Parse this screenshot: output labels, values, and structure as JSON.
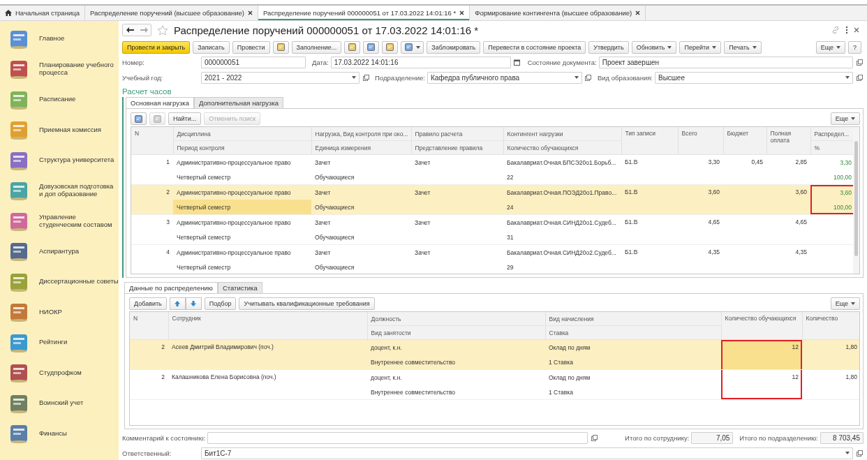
{
  "top_tabs": [
    {
      "label": "Начальная страница",
      "home": true,
      "closable": false,
      "selected": false
    },
    {
      "label": "Распределение поручений (высшее образование)",
      "home": false,
      "closable": true,
      "selected": false
    },
    {
      "label": "Распределение поручений 000000051 от 17.03.2022 14:01:16 *",
      "home": false,
      "closable": true,
      "selected": true
    },
    {
      "label": "Формирование контингента (высшее образование)",
      "home": false,
      "closable": true,
      "selected": false
    }
  ],
  "sidebar": {
    "items": [
      {
        "label": "Главное"
      },
      {
        "label": "Планирование учебного процесса"
      },
      {
        "label": "Расписание"
      },
      {
        "label": "Приемная комиссия"
      },
      {
        "label": "Структура университета"
      },
      {
        "label": "Довузовская подготовка и доп образование"
      },
      {
        "label": "Управление студенческим составом"
      },
      {
        "label": "Аспирантура"
      },
      {
        "label": "Диссертационные советы"
      },
      {
        "label": "НИОКР"
      },
      {
        "label": "Рейтинги"
      },
      {
        "label": "Студпрофком"
      },
      {
        "label": "Воинский учет"
      },
      {
        "label": "Финансы"
      }
    ]
  },
  "document": {
    "title": "Распределение поручений 000000051 от 17.03.2022 14:01:16 *",
    "command_bar": [
      {
        "kind": "primary",
        "label": "Провести и закрыть"
      },
      {
        "kind": "plain",
        "label": "Записать"
      },
      {
        "kind": "plain",
        "label": "Провести"
      },
      {
        "kind": "icon"
      },
      {
        "kind": "plain",
        "label": "Заполнение..."
      },
      {
        "kind": "icon"
      },
      {
        "kind": "icon"
      },
      {
        "kind": "icon"
      },
      {
        "kind": "icon_menu"
      },
      {
        "kind": "plain",
        "label": "Заблокировать"
      },
      {
        "kind": "plain",
        "label": "Перевести в состояние проекта"
      },
      {
        "kind": "plain",
        "label": "Утвердить"
      },
      {
        "kind": "menu",
        "label": "Обновить"
      },
      {
        "kind": "menu",
        "label": "Перейти"
      },
      {
        "kind": "menu",
        "label": "Печать"
      },
      {
        "kind": "spacer"
      },
      {
        "kind": "menu",
        "label": "Еще"
      },
      {
        "kind": "plain",
        "label": "?"
      }
    ],
    "number": {
      "label": "Номер:",
      "value": "000000051"
    },
    "date": {
      "label": "Дата:",
      "value": "17.03.2022 14:01:16"
    },
    "state": {
      "label": "Состояние документа:",
      "value": "Проект завершен"
    },
    "year": {
      "label": "Учебный год:",
      "value": "2021 - 2022"
    },
    "department": {
      "label": "Подразделение:",
      "value": "Кафедра публичного права"
    },
    "education": {
      "label": "Вид образования:",
      "value": "Высшее"
    },
    "section_title": "Расчет часов",
    "load_tabs": [
      {
        "label": "Основная нагрузка",
        "selected": true
      },
      {
        "label": "Дополнительная нагрузка",
        "selected": false
      }
    ],
    "load_toolbar": [
      {
        "kind": "icon",
        "disabled": false
      },
      {
        "kind": "icon",
        "disabled": true
      },
      {
        "kind": "plain",
        "label": "Найти...",
        "disabled": false
      },
      {
        "kind": "plain",
        "label": "Отменить поиск",
        "disabled": true
      },
      {
        "kind": "spacer"
      },
      {
        "kind": "menu",
        "label": "Еще",
        "disabled": false
      }
    ],
    "load_table": {
      "columns": [
        {
          "top": "N"
        },
        {
          "top": "Дисциплина",
          "bottom": "Период контроля"
        },
        {
          "top": "Нагрузка, Вид контроля при око...",
          "bottom": "Единица измерения"
        },
        {
          "top": "Правило расчета",
          "bottom": "Представление правила"
        },
        {
          "top": "Контингент нагрузки",
          "bottom": "Количество обучающихся"
        },
        {
          "top": "Тип записи"
        },
        {
          "top": "Всего"
        },
        {
          "top": "Бюджет"
        },
        {
          "top": "Полная оплата"
        },
        {
          "top": "Распредел...",
          "bottom": "%"
        }
      ],
      "rows": [
        {
          "n": "1",
          "discipline": "Административно-процессуальное право",
          "period": "Четвертый семестр",
          "load": "Зачет",
          "unit": "Обучающиеся",
          "rule": "Зачет",
          "contingent": "Бакалавриат.Очная.БПСЭ20о1.Борьб...",
          "students": "22",
          "record_type": "Б1.В",
          "total": "3,30",
          "budget": "0,45",
          "full_pay": "2,85",
          "dist": "3,30",
          "dist_pct": "100,00",
          "selected": false,
          "focused": false,
          "marked": false
        },
        {
          "n": "2",
          "discipline": "Административно-процессуальное право",
          "period": "Четвертый семестр",
          "load": "Зачет",
          "unit": "Обучающиеся",
          "rule": "Зачет",
          "contingent": "Бакалавриат.Очная.ПОЭД20о1.Право...",
          "students": "24",
          "record_type": "Б1.В",
          "total": "3,60",
          "full_pay": "3,60",
          "dist": "3,60",
          "dist_pct": "100,00",
          "selected": true,
          "focused": true,
          "marked": true
        },
        {
          "n": "3",
          "discipline": "Административно-процессуальное право",
          "period": "Четвертый семестр",
          "load": "Зачет",
          "unit": "Обучающиеся",
          "rule": "Зачет",
          "contingent": "Бакалавриат.Очная.СИНД20о1.Судеб...",
          "students": "31",
          "record_type": "Б1.В",
          "total": "4,65",
          "full_pay": "4,65",
          "selected": false,
          "focused": false,
          "marked": false
        },
        {
          "n": "4",
          "discipline": "Административно-процессуальное право",
          "period": "Четвертый семестр",
          "load": "Зачет",
          "unit": "Обучающиеся",
          "rule": "Зачет",
          "contingent": "Бакалавриат.Очная.СИНД20о2.Судеб...",
          "students": "29",
          "record_type": "Б1.В",
          "total": "4,35",
          "full_pay": "4,35",
          "selected": false,
          "focused": false,
          "marked": false
        }
      ]
    },
    "detail_tabs": [
      {
        "label": "Данные по распределению",
        "selected": true
      },
      {
        "label": "Статистика",
        "selected": false
      }
    ],
    "detail_toolbar": [
      {
        "kind": "plain",
        "label": "Добавить"
      },
      {
        "kind": "updown"
      },
      {
        "kind": "plain",
        "label": "Подбор"
      },
      {
        "kind": "plain",
        "label": "Учитывать квалификационные требования"
      },
      {
        "kind": "spacer"
      },
      {
        "kind": "menu",
        "label": "Еще"
      }
    ],
    "detail_table": {
      "columns": [
        {
          "top": "N"
        },
        {
          "top": "Сотрудник"
        },
        {
          "top": "Должность",
          "bottom": "Вид занятости"
        },
        {
          "top": "Вид начисления",
          "bottom": "Ставка"
        },
        {
          "top": "Количество обучающихся"
        },
        {
          "top": "Количество"
        }
      ],
      "rows": [
        {
          "n": "2",
          "employee": "Асеев Дмитрий Владимирович (поч.)",
          "position": "доцент, к.н.",
          "employment": "Внутреннее совместительство",
          "accrual": "Оклад по дням",
          "rate": "1 Ставка",
          "students": "12",
          "amount": "1,80",
          "selected": true,
          "focused": true,
          "marked": true
        },
        {
          "n": "2",
          "employee": "Калашникова Елена Борисовна (поч.)",
          "position": "доцент, к.н.",
          "employment": "Внутреннее совместительство",
          "accrual": "Оклад по дням",
          "rate": "1 Ставка",
          "students": "12",
          "amount": "1,80",
          "selected": false,
          "focused": false,
          "marked": true
        }
      ]
    },
    "comment": {
      "label": "Комментарий к состоянию:"
    },
    "employee_total": {
      "label": "Итого по сотруднику:",
      "value": "7,05"
    },
    "department_total": {
      "label": "Итого по подразделению:",
      "value": "8 703,45"
    },
    "responsible": {
      "label": "Ответственный:",
      "value": "Бит1С-7"
    }
  }
}
